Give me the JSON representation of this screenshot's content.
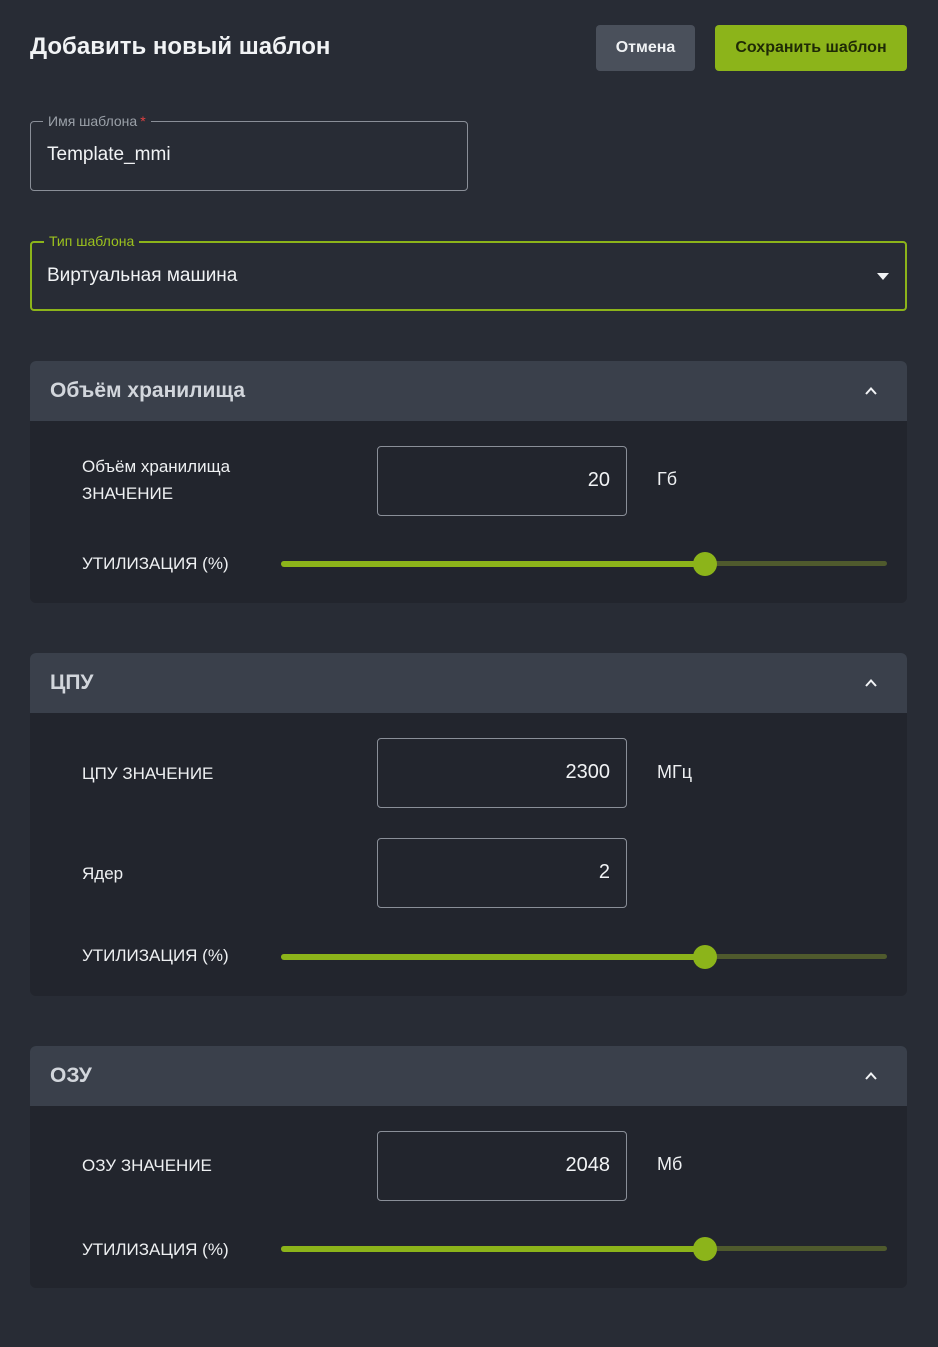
{
  "header": {
    "title": "Добавить новый шаблон",
    "cancel_label": "Отмена",
    "save_label": "Сохранить шаблон"
  },
  "template_name": {
    "label": "Имя шаблона",
    "required_mark": "*",
    "value": "Template_mmi"
  },
  "template_type": {
    "label": "Тип шаблона",
    "value": "Виртуальная машина"
  },
  "storage": {
    "title": "Объём хранилища",
    "value_label_line1": "Объём хранилища",
    "value_label_line2": "ЗНАЧЕНИЕ",
    "value": "20",
    "unit": "Гб",
    "utilization_label": "УТИЛИЗАЦИЯ (%)",
    "utilization": 70
  },
  "cpu": {
    "title": "ЦПУ",
    "value_label": "ЦПУ ЗНАЧЕНИЕ",
    "value": "2300",
    "unit": "МГц",
    "cores_label": "Ядер",
    "cores": "2",
    "utilization_label": "УТИЛИЗАЦИЯ (%)",
    "utilization": 70
  },
  "ram": {
    "title": "ОЗУ",
    "value_label": "ОЗУ ЗНАЧЕНИЕ",
    "value": "2048",
    "unit": "Мб",
    "utilization_label": "УТИЛИЗАЦИЯ (%)",
    "utilization": 70
  },
  "colors": {
    "accent": "#8cb41a",
    "background": "#282c35",
    "panel": "#22252d",
    "panel_header": "#3a404b"
  }
}
